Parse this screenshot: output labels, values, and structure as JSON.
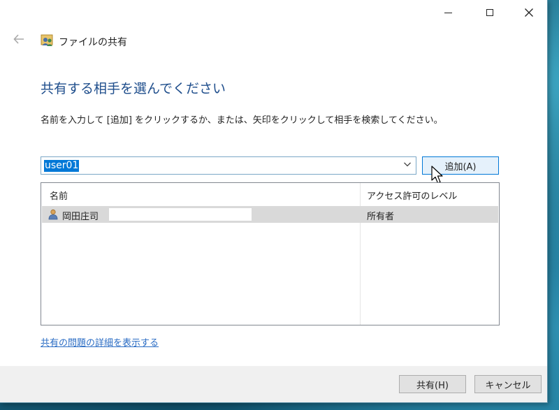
{
  "window": {
    "title": "ファイルの共有",
    "heading": "共有する相手を選んでください",
    "instruction": "名前を入力して [追加] をクリックするか、または、矢印をクリックして相手を検索してください。"
  },
  "combo": {
    "value": "user01"
  },
  "add_button": {
    "label": "追加(A)"
  },
  "list": {
    "columns": [
      "名前",
      "アクセス許可のレベル"
    ],
    "rows": [
      {
        "name": "岡田庄司",
        "level": "所有者"
      }
    ]
  },
  "link": {
    "label": "共有の問題の詳細を表示する"
  },
  "buttons": {
    "share": "共有(H)",
    "cancel": "キャンセル"
  },
  "colors": {
    "accent": "#0078d7",
    "heading": "#1f4e8c",
    "link": "#2a6cc4"
  },
  "icons": [
    "back-arrow-icon",
    "share-users-icon",
    "user-icon",
    "chevron-down-icon",
    "minimize-icon",
    "maximize-icon",
    "close-icon",
    "mouse-pointer-icon"
  ]
}
